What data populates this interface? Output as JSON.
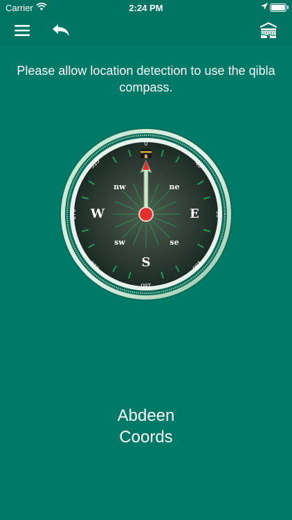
{
  "status_bar": {
    "carrier": "Carrier",
    "time": "2:24 PM"
  },
  "nav": {
    "menu_icon": "hamburger-menu-icon",
    "back_icon": "undo-arrow-icon",
    "right_icon": "kaaba-icon"
  },
  "prompt": "Please allow location detection to use the qibla compass.",
  "compass": {
    "cardinals": {
      "n": "0",
      "e": "E",
      "s": "S",
      "w": "W"
    },
    "intercardinals": {
      "nw": "nw",
      "ne": "ne",
      "sw": "sw",
      "se": "se"
    },
    "degrees": {
      "d0": "0",
      "d45": "45",
      "d90": "90",
      "d135": "135",
      "d180": "180",
      "d225": "225",
      "d270": "270",
      "d315": "315"
    }
  },
  "location": {
    "line1": "Abdeen",
    "line2": "Coords"
  },
  "colors": {
    "background": "#007a68",
    "bar": "#007563",
    "needle": "#e3302f",
    "compass_face": "#2b3a33"
  }
}
